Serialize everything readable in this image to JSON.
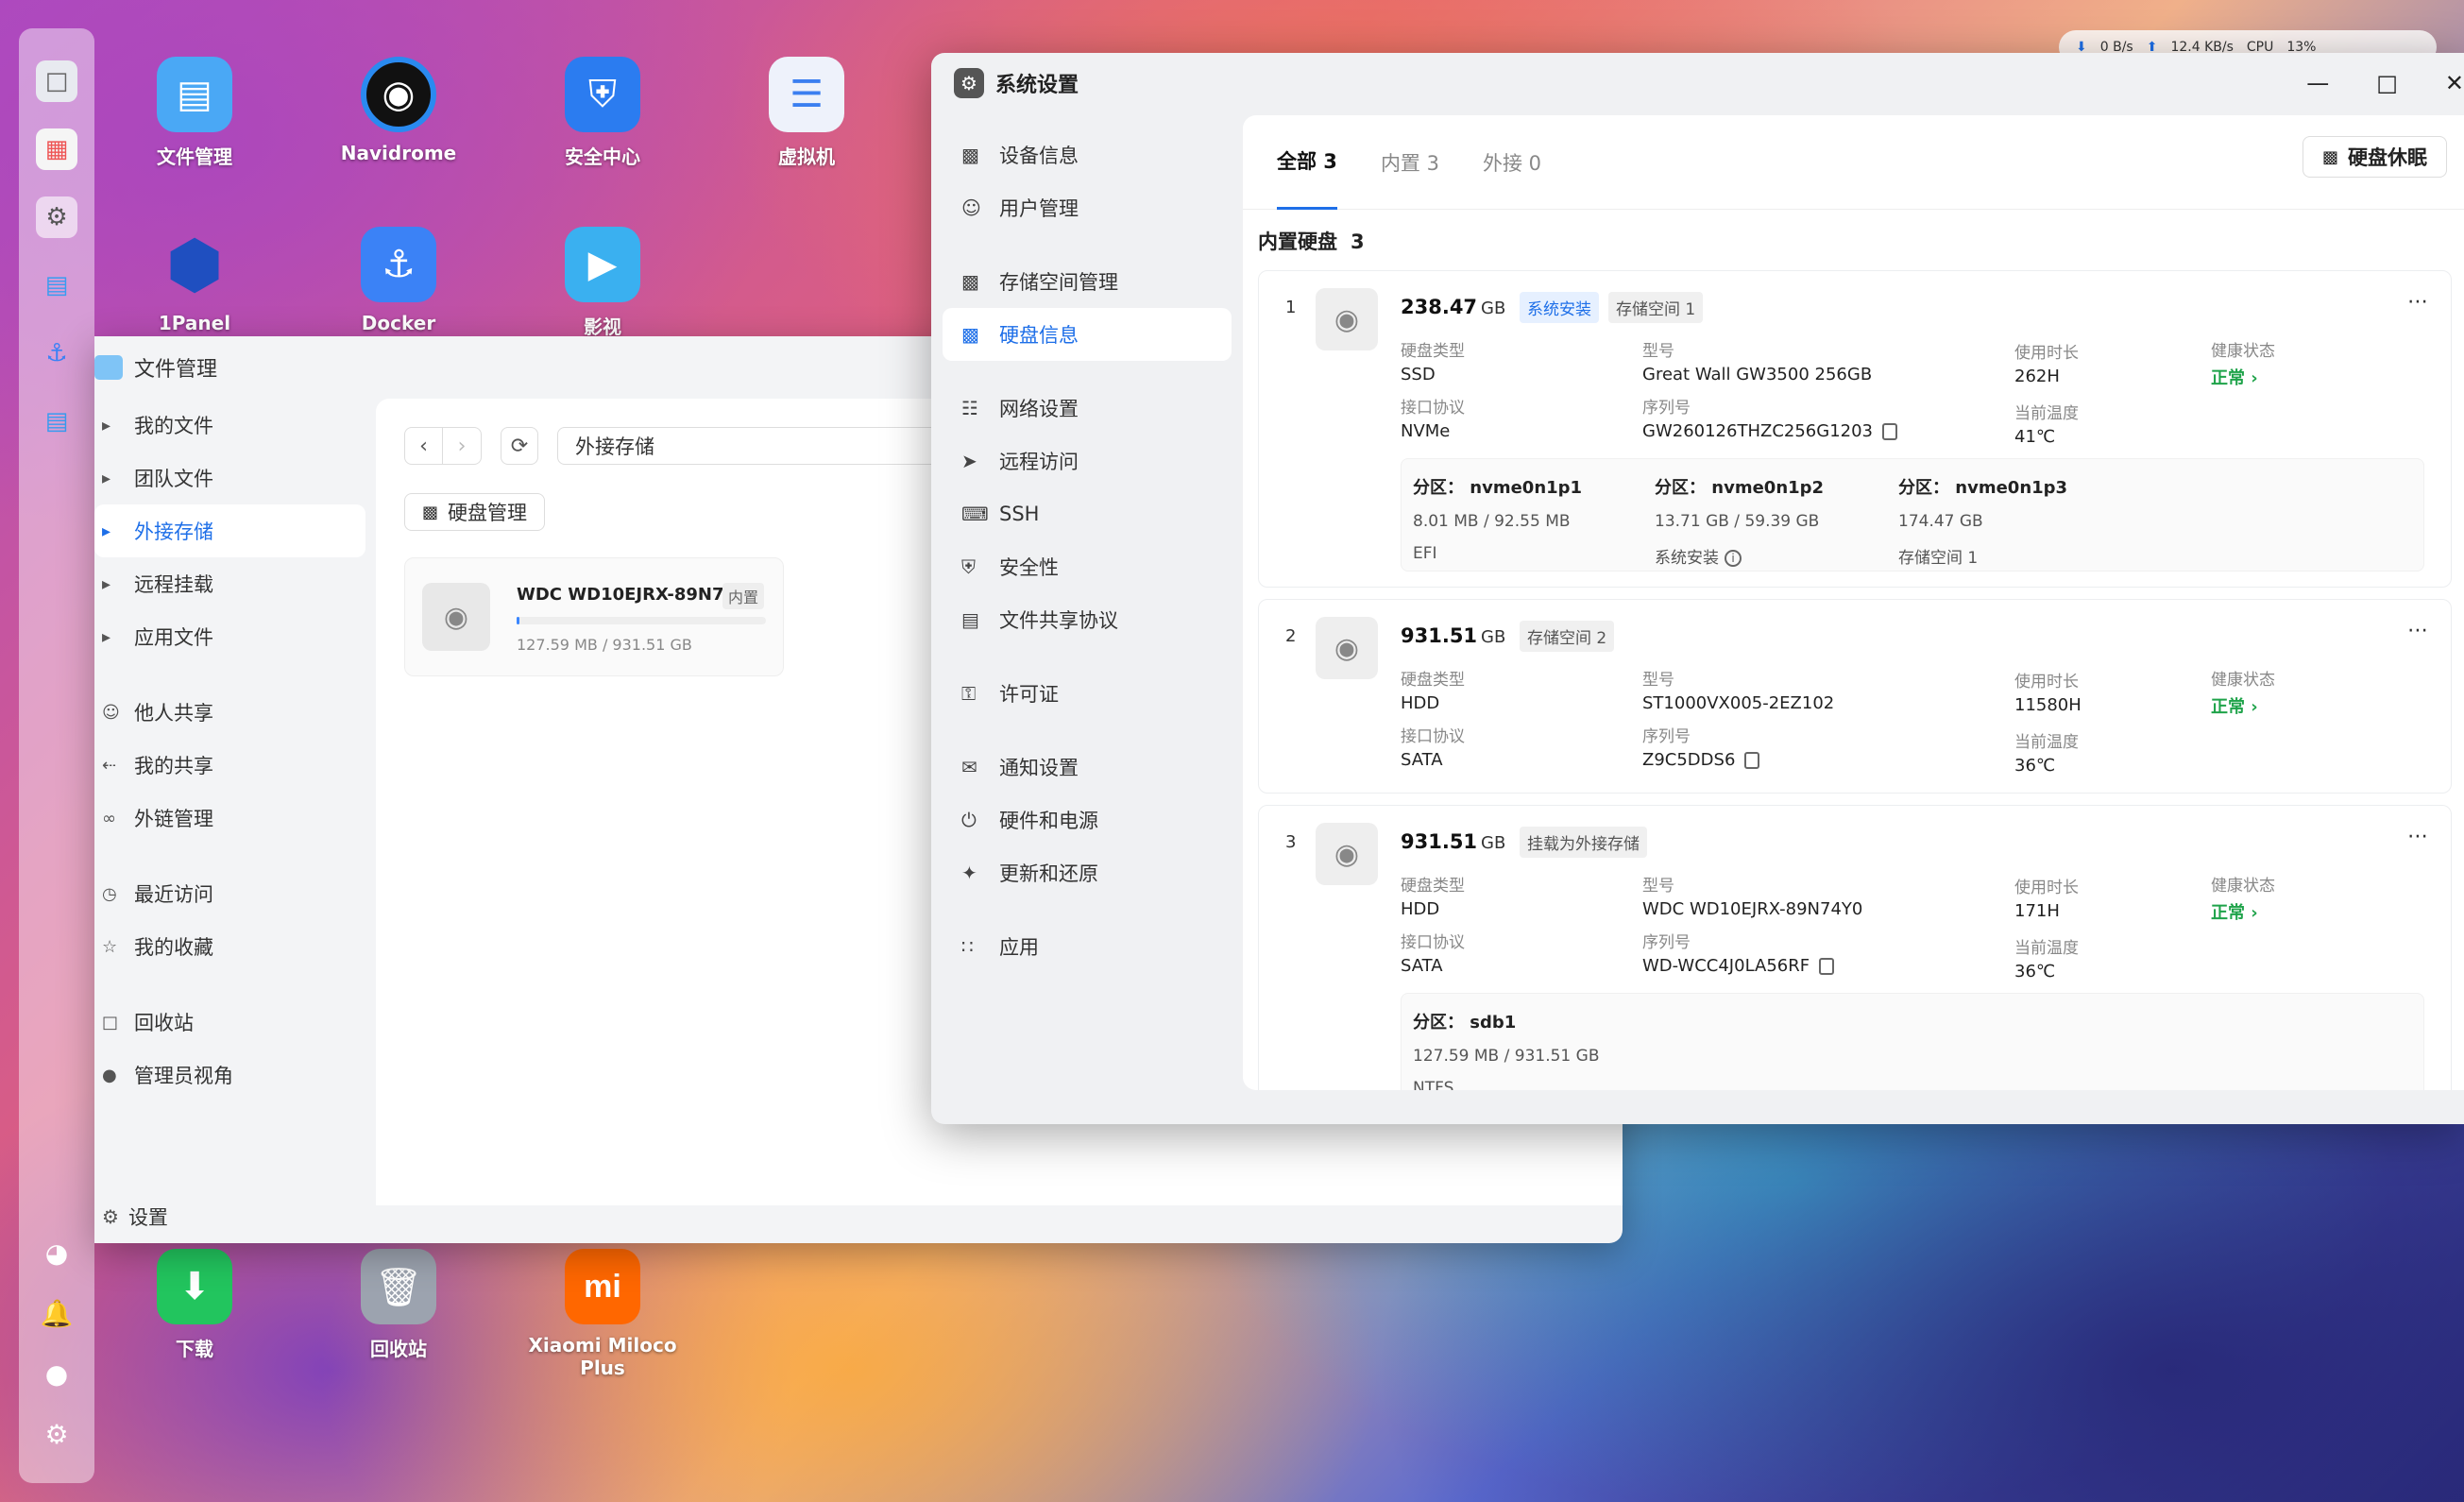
{
  "desktop": {
    "icons_top": [
      {
        "label": "文件管理",
        "icon": "folder-icon",
        "color": "#4aa8f5"
      },
      {
        "label": "Navidrome",
        "icon": "vinyl-icon",
        "color": "#1a1a2a"
      },
      {
        "label": "安全中心",
        "icon": "shield-icon",
        "color": "#2b7cf0"
      },
      {
        "label": "虚拟机",
        "icon": "server-icon",
        "color": "#5a9ff5"
      },
      {
        "label": "1Panel",
        "icon": "hexagon-icon",
        "color": "#2a6ae0"
      },
      {
        "label": "Docker",
        "icon": "docker-icon",
        "color": "#3b82f6"
      },
      {
        "label": "影视",
        "icon": "film-icon",
        "color": "#3ab0f0"
      }
    ],
    "icons_bottom": [
      {
        "label": "下载",
        "icon": "download-icon",
        "color": "#22c55e"
      },
      {
        "label": "回收站",
        "icon": "trash-icon",
        "color": "#9ca3af"
      },
      {
        "label": "Xiaomi Miloco Plus",
        "icon": "mi-icon",
        "color": "#ff6700"
      }
    ]
  },
  "statusbar": {
    "net_down": "0 B/s",
    "net_up": "12.4 KB/s",
    "cpu_label": "CPU",
    "cpu_value": "13%"
  },
  "file_manager": {
    "title": "文件管理",
    "sidebar": [
      {
        "label": "我的文件",
        "icon": "caret-icon"
      },
      {
        "label": "团队文件",
        "icon": "caret-icon"
      },
      {
        "label": "外接存储",
        "icon": "caret-icon",
        "active": true
      },
      {
        "label": "远程挂载",
        "icon": "caret-icon"
      },
      {
        "label": "应用文件",
        "icon": "caret-icon"
      },
      {
        "label": "他人共享",
        "icon": "users-icon"
      },
      {
        "label": "我的共享",
        "icon": "share-icon"
      },
      {
        "label": "外链管理",
        "icon": "link-icon"
      },
      {
        "label": "最近访问",
        "icon": "clock-icon"
      },
      {
        "label": "我的收藏",
        "icon": "star-icon"
      },
      {
        "label": "回收站",
        "icon": "trash-icon"
      },
      {
        "label": "管理员视角",
        "icon": "admin-icon"
      }
    ],
    "settings_label": "设置",
    "path": "外接存储",
    "disk_manage_btn": "硬盘管理",
    "disk": {
      "name": "WDC WD10EJRX-89N7...",
      "tag": "内置",
      "size": "127.59 MB / 931.51 GB",
      "usage_fraction": 0.0001
    }
  },
  "system_settings": {
    "title": "系统设置",
    "nav": [
      {
        "label": "设备信息",
        "icon": "device-icon"
      },
      {
        "label": "用户管理",
        "icon": "user-icon"
      },
      {
        "label": "存储空间管理",
        "icon": "storage-icon"
      },
      {
        "label": "硬盘信息",
        "icon": "disk-icon",
        "active": true
      },
      {
        "label": "网络设置",
        "icon": "network-icon"
      },
      {
        "label": "远程访问",
        "icon": "send-icon"
      },
      {
        "label": "SSH",
        "icon": "terminal-icon"
      },
      {
        "label": "安全性",
        "icon": "shield-icon"
      },
      {
        "label": "文件共享协议",
        "icon": "doc-icon"
      },
      {
        "label": "许可证",
        "icon": "key-icon"
      },
      {
        "label": "通知设置",
        "icon": "mail-icon"
      },
      {
        "label": "硬件和电源",
        "icon": "power-icon"
      },
      {
        "label": "更新和还原",
        "icon": "rocket-icon"
      },
      {
        "label": "应用",
        "icon": "apps-icon"
      }
    ],
    "tabs": [
      {
        "label": "全部 3",
        "active": true
      },
      {
        "label": "内置 3"
      },
      {
        "label": "外接 0"
      }
    ],
    "sleep_btn": "硬盘休眠",
    "section_title": "内置硬盘",
    "section_count": "3",
    "labels": {
      "type": "硬盘类型",
      "protocol": "接口协议",
      "model": "型号",
      "serial": "序列号",
      "hours": "使用时长",
      "temp": "当前温度",
      "health": "健康状态",
      "partition_prefix": "分区："
    },
    "disks": [
      {
        "index": "1",
        "capacity": "238.47",
        "unit": "GB",
        "tags": [
          "系统安装",
          "存储空间 1"
        ],
        "type": "SSD",
        "protocol": "NVMe",
        "model": "Great Wall GW3500 256GB",
        "serial": "GW260126THZC256G1203",
        "hours": "262H",
        "temp": "41℃",
        "health": "正常",
        "partitions": [
          {
            "name": "nvme0n1p1",
            "size": "8.01 MB / 92.55 MB",
            "fs": "EFI"
          },
          {
            "name": "nvme0n1p2",
            "size": "13.71 GB / 59.39 GB",
            "fs": "系统安装"
          },
          {
            "name": "nvme0n1p3",
            "size": "174.47 GB",
            "fs": "存储空间 1"
          }
        ]
      },
      {
        "index": "2",
        "capacity": "931.51",
        "unit": "GB",
        "tags": [
          "存储空间 2"
        ],
        "type": "HDD",
        "protocol": "SATA",
        "model": "ST1000VX005-2EZ102",
        "serial": "Z9C5DDS6",
        "hours": "11580H",
        "temp": "36℃",
        "health": "正常"
      },
      {
        "index": "3",
        "capacity": "931.51",
        "unit": "GB",
        "tags": [
          "挂载为外接存储"
        ],
        "type": "HDD",
        "protocol": "SATA",
        "model": "WDC WD10EJRX-89N74Y0",
        "serial": "WD-WCC4J0LA56RF",
        "hours": "171H",
        "temp": "36℃",
        "health": "正常",
        "partitions": [
          {
            "name": "sdb1",
            "size": "127.59 MB / 931.51 GB",
            "fs": "NTFS"
          }
        ]
      }
    ]
  }
}
